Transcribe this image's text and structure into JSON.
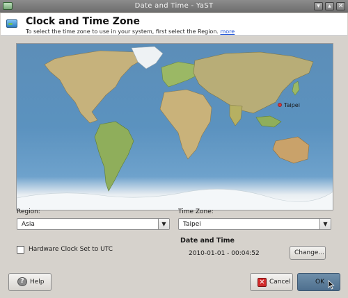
{
  "window": {
    "title": "Date and Time - YaST",
    "controls": [
      "min-icon",
      "max-icon",
      "close-icon"
    ]
  },
  "header": {
    "title": "Clock and Time Zone",
    "description": "To select the time zone to use in your system, first select the Region.",
    "more_link": "more"
  },
  "map": {
    "selected_city": "Taipei",
    "marker_color": "#d63a3a"
  },
  "region": {
    "label": "Region:",
    "value": "Asia"
  },
  "timezone": {
    "label": "Time Zone:",
    "value": "Taipei"
  },
  "hardware_clock": {
    "label": "Hardware Clock Set to UTC",
    "checked": false
  },
  "date_time": {
    "heading": "Date and Time",
    "value": "2010-01-01 - 00:04:52",
    "change_label": "Change..."
  },
  "buttons": {
    "help": "Help",
    "cancel": "Cancel",
    "ok": "OK"
  },
  "colors": {
    "accent": "#5a7a99",
    "link": "#1a4fd6",
    "ocean": "#5b92bf",
    "land": "#c9b27a"
  }
}
